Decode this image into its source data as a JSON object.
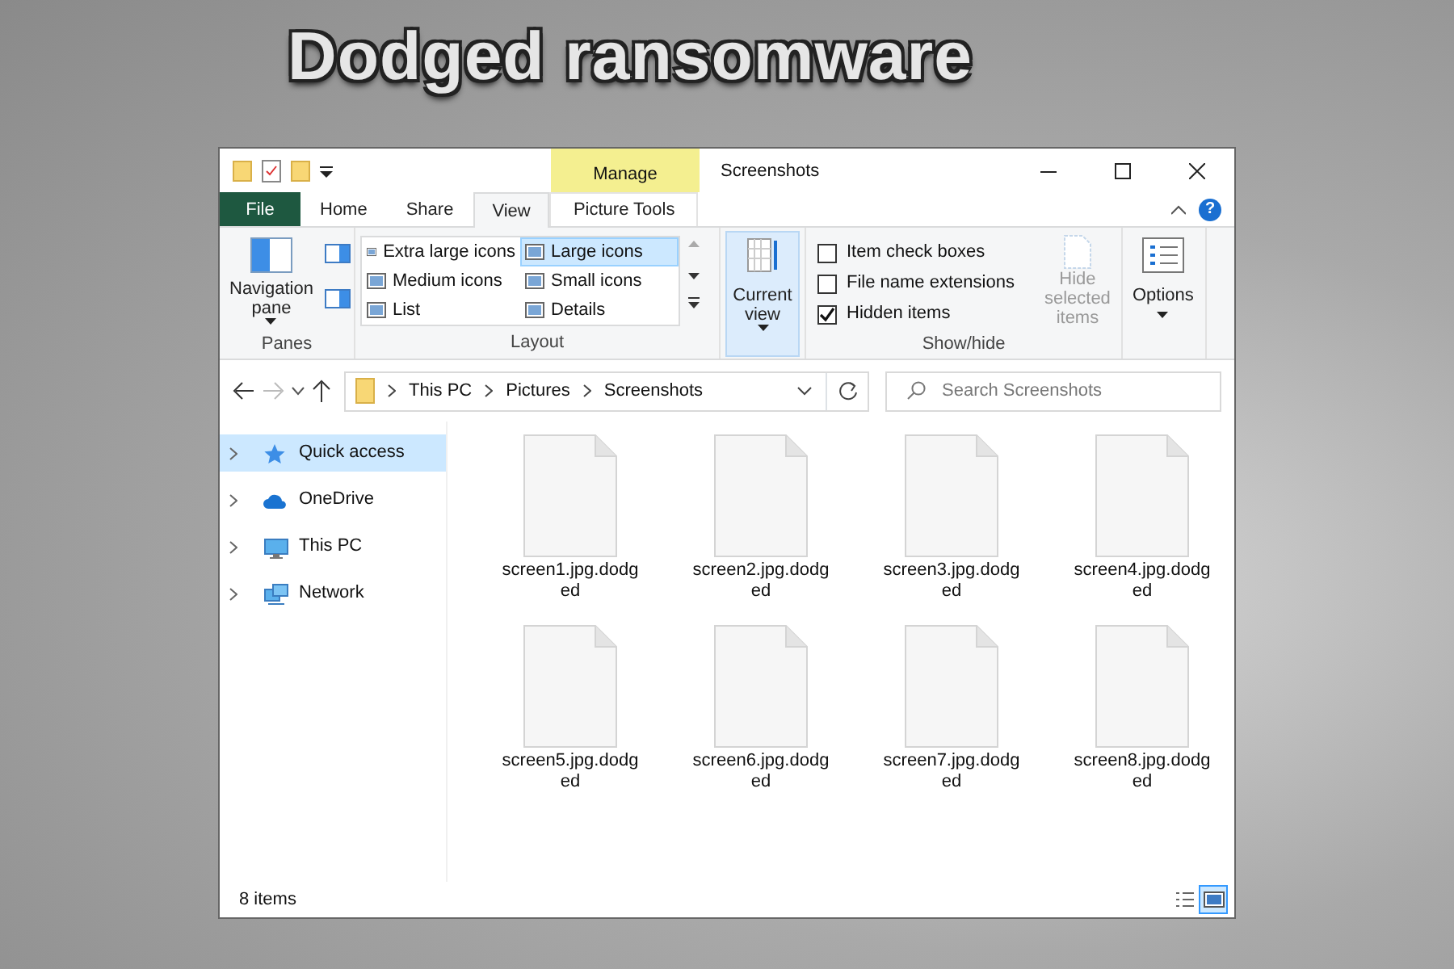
{
  "headline": "Dodged ransomware",
  "window": {
    "title": "Screenshots",
    "context_group": "Manage",
    "help": "?"
  },
  "tabs": [
    {
      "label": "File",
      "kind": "file",
      "selected": false
    },
    {
      "label": "Home",
      "kind": "tab",
      "selected": false
    },
    {
      "label": "Share",
      "kind": "tab",
      "selected": false
    },
    {
      "label": "View",
      "kind": "tab",
      "selected": true
    },
    {
      "label": "Picture Tools",
      "kind": "context",
      "selected": false
    }
  ],
  "ribbon": {
    "panes": {
      "label": "Panes",
      "button": "Navigation pane"
    },
    "layout": {
      "label": "Layout",
      "items": [
        {
          "label": "Extra large icons",
          "selected": false
        },
        {
          "label": "Large icons",
          "selected": true
        },
        {
          "label": "Medium icons",
          "selected": false
        },
        {
          "label": "Small icons",
          "selected": false
        },
        {
          "label": "List",
          "selected": false
        },
        {
          "label": "Details",
          "selected": false
        }
      ]
    },
    "current_view": {
      "label": "Current view",
      "pressed": true
    },
    "show_hide": {
      "label": "Show/hide",
      "checkboxes": [
        {
          "label": "Item check boxes",
          "checked": false
        },
        {
          "label": "File name extensions",
          "checked": false
        },
        {
          "label": "Hidden items",
          "checked": true
        }
      ],
      "hide_selected": {
        "label": "Hide selected items",
        "disabled": true
      }
    },
    "options": {
      "label": "Options"
    }
  },
  "address": {
    "path": [
      "This PC",
      "Pictures",
      "Screenshots"
    ],
    "search_placeholder": "Search Screenshots"
  },
  "sidebar": {
    "items": [
      {
        "label": "Quick access",
        "selected": true
      },
      {
        "label": "OneDrive",
        "selected": false
      },
      {
        "label": "This PC",
        "selected": false
      },
      {
        "label": "Network",
        "selected": false
      }
    ]
  },
  "files": [
    "screen1.jpg.dodged",
    "screen2.jpg.dodged",
    "screen3.jpg.dodged",
    "screen4.jpg.dodged",
    "screen5.jpg.dodged",
    "screen6.jpg.dodged",
    "screen7.jpg.dodged",
    "screen8.jpg.dodged"
  ],
  "status_bar": {
    "count": "8 items",
    "views": [
      {
        "kind": "details",
        "selected": false
      },
      {
        "kind": "large",
        "selected": true
      }
    ]
  }
}
